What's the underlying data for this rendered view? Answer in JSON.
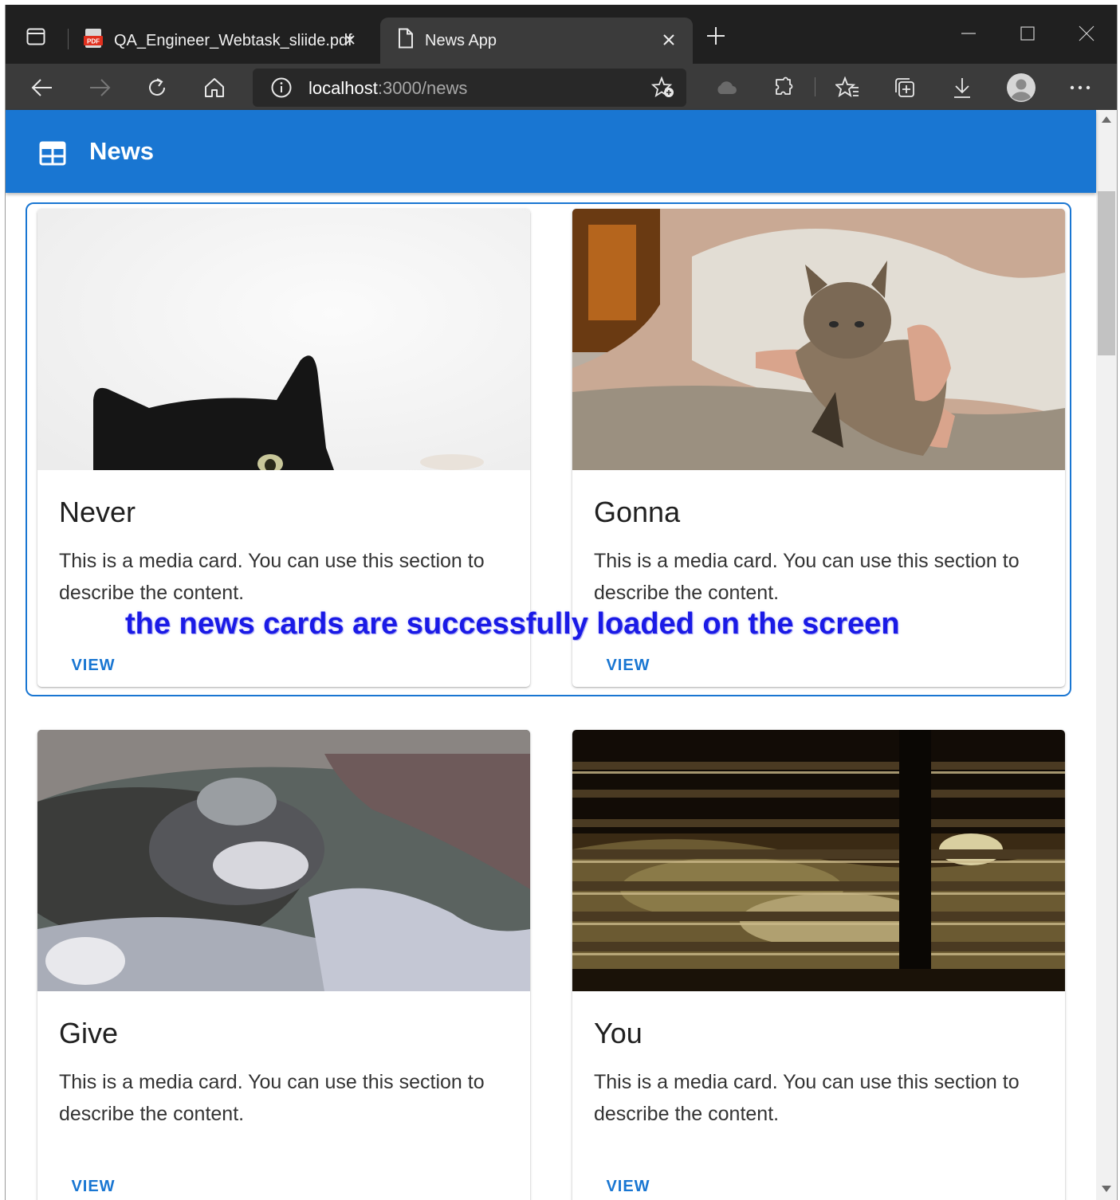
{
  "browser": {
    "tabs": [
      {
        "title": "QA_Engineer_Webtask_sliide.pdf",
        "icon": "pdf-icon",
        "active": false
      },
      {
        "title": "News App",
        "icon": "page-icon",
        "active": true
      }
    ],
    "address": {
      "host": "localhost",
      "path": ":3000/news"
    }
  },
  "app": {
    "title": "News",
    "icon": "newspaper-icon",
    "primary_color": "#1976d2"
  },
  "cards": [
    {
      "title": "Never",
      "description": "This is a media card. You can use this section to describe the content.",
      "button": "VIEW",
      "image": "black cat peeking from bottom"
    },
    {
      "title": "Gonna",
      "description": "This is a media card. You can use this section to describe the content.",
      "button": "VIEW",
      "image": "kitten held in hands"
    },
    {
      "title": "Give",
      "description": "This is a media card. You can use this section to describe the content.",
      "button": "VIEW",
      "image": "blurry cat"
    },
    {
      "title": "You",
      "description": "This is a media card. You can use this section to describe the content.",
      "button": "VIEW",
      "image": "sunlight through blinds"
    }
  ],
  "annotation": "the news cards are successfully loaded on the screen"
}
